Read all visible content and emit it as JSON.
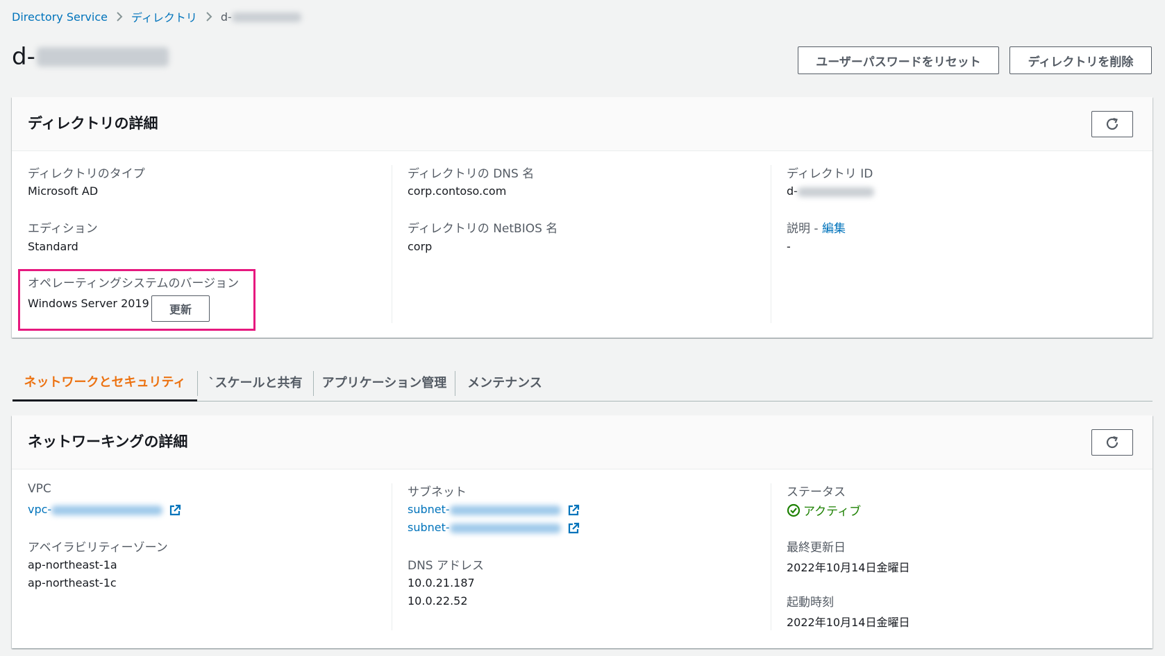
{
  "breadcrumb": {
    "items": [
      "Directory Service",
      "ディレクトリ"
    ],
    "current_prefix": "d-"
  },
  "page": {
    "title_prefix": "d-",
    "reset_password_label": "ユーザーパスワードをリセット",
    "delete_directory_label": "ディレクトリを削除"
  },
  "directory_details": {
    "title": "ディレクトリの詳細",
    "type_label": "ディレクトリのタイプ",
    "type_value": "Microsoft AD",
    "edition_label": "エディション",
    "edition_value": "Standard",
    "os_label": "オペレーティングシステムのバージョン",
    "os_value": "Windows Server 2019",
    "update_label": "更新",
    "dns_name_label": "ディレクトリの DNS 名",
    "dns_name_value": "corp.contoso.com",
    "netbios_label": "ディレクトリの NetBIOS 名",
    "netbios_value": "corp",
    "id_label": "ディレクトリ ID",
    "id_value_prefix": "d-",
    "description_label": "説明 - ",
    "description_edit": "編集",
    "description_value": "-"
  },
  "tabs": [
    {
      "label": "ネットワークとセキュリティ"
    },
    {
      "label": "`スケールと共有"
    },
    {
      "label": "アプリケーション管理"
    },
    {
      "label": "メンテナンス"
    }
  ],
  "networking": {
    "title": "ネットワーキングの詳細",
    "vpc_label": "VPC",
    "vpc_prefix": "vpc-",
    "az_label": "アベイラビリティーゾーン",
    "az_values": [
      "ap-northeast-1a",
      "ap-northeast-1c"
    ],
    "subnet_label": "サブネット",
    "subnet_prefixes": [
      "subnet-",
      "subnet-"
    ],
    "dns_address_label": "DNS アドレス",
    "dns_addresses": [
      "10.0.21.187",
      "10.0.22.52"
    ],
    "status_label": "ステータス",
    "status_value": "アクティブ",
    "last_updated_label": "最終更新日",
    "last_updated_value": "2022年10月14日金曜日",
    "launch_time_label": "起動時刻",
    "launch_time_value": "2022年10月14日金曜日"
  },
  "colors": {
    "link": "#0073bb",
    "active_tab": "#ec7211",
    "highlight": "#e6197f",
    "status_ok": "#1d8102"
  }
}
